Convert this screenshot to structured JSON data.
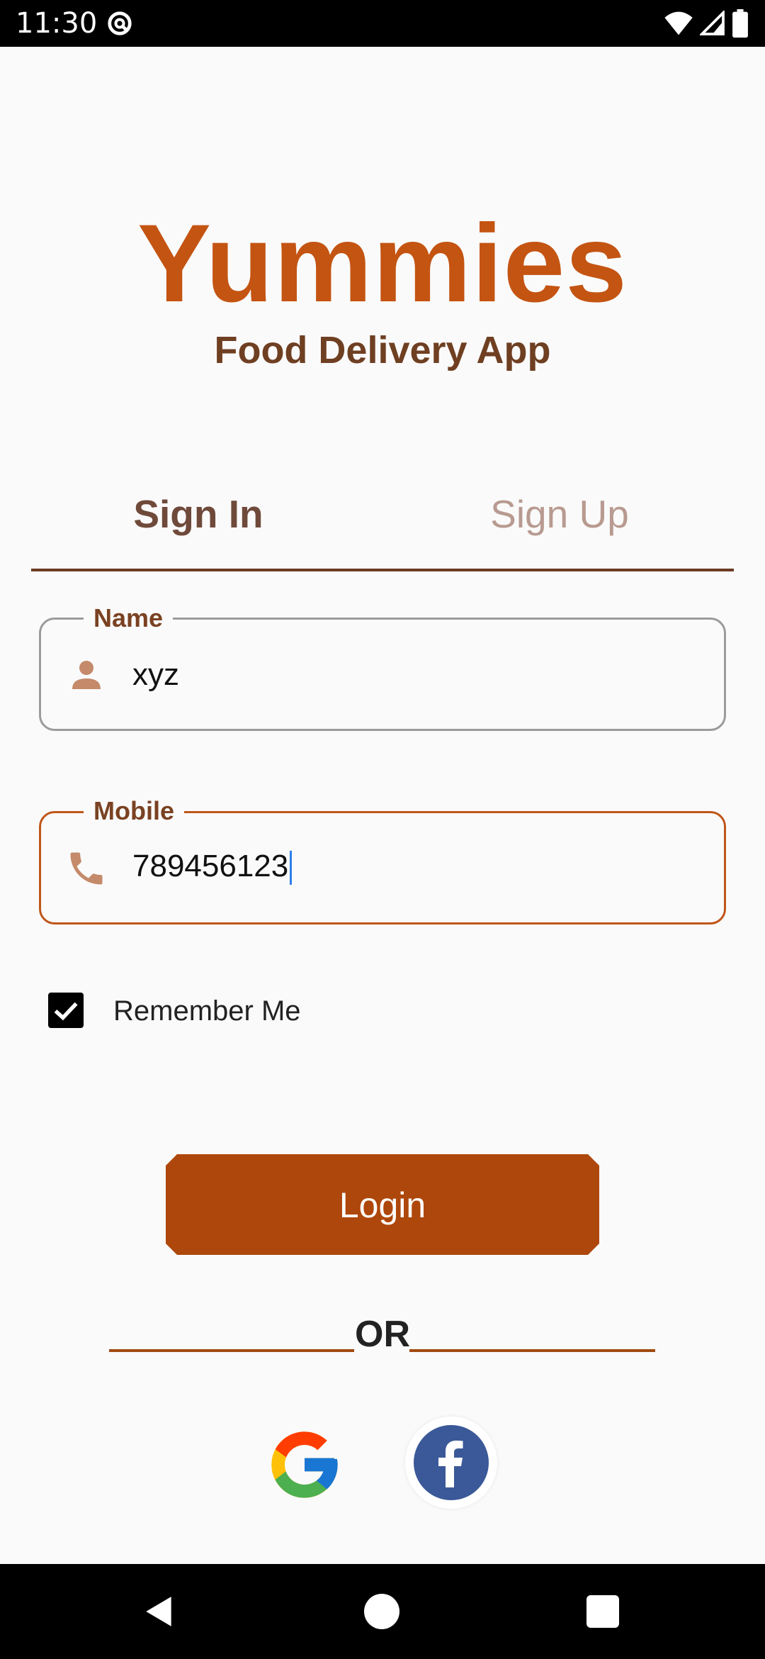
{
  "status_bar": {
    "time": "11:30",
    "icons": [
      "at-sign-icon",
      "wifi-icon",
      "cellular-signal-icon",
      "battery-icon"
    ]
  },
  "header": {
    "title": "Yummies",
    "subtitle": "Food Delivery App"
  },
  "tabs": [
    {
      "label": "Sign In",
      "active": true
    },
    {
      "label": "Sign Up",
      "active": false
    }
  ],
  "form": {
    "name": {
      "label": "Name",
      "value": "xyz",
      "icon": "person-icon"
    },
    "mobile": {
      "label": "Mobile",
      "value": "789456123",
      "icon": "phone-icon",
      "focused": true
    },
    "remember_me": {
      "label": "Remember Me",
      "checked": true
    }
  },
  "login_button": {
    "label": "Login"
  },
  "divider": {
    "text": "OR"
  },
  "social": {
    "buttons": [
      "google-icon",
      "facebook-icon"
    ]
  },
  "colors": {
    "brand": "#c45412",
    "button": "#ae470b",
    "subtitle": "#6f3f22",
    "facebook": "#3b5998"
  }
}
